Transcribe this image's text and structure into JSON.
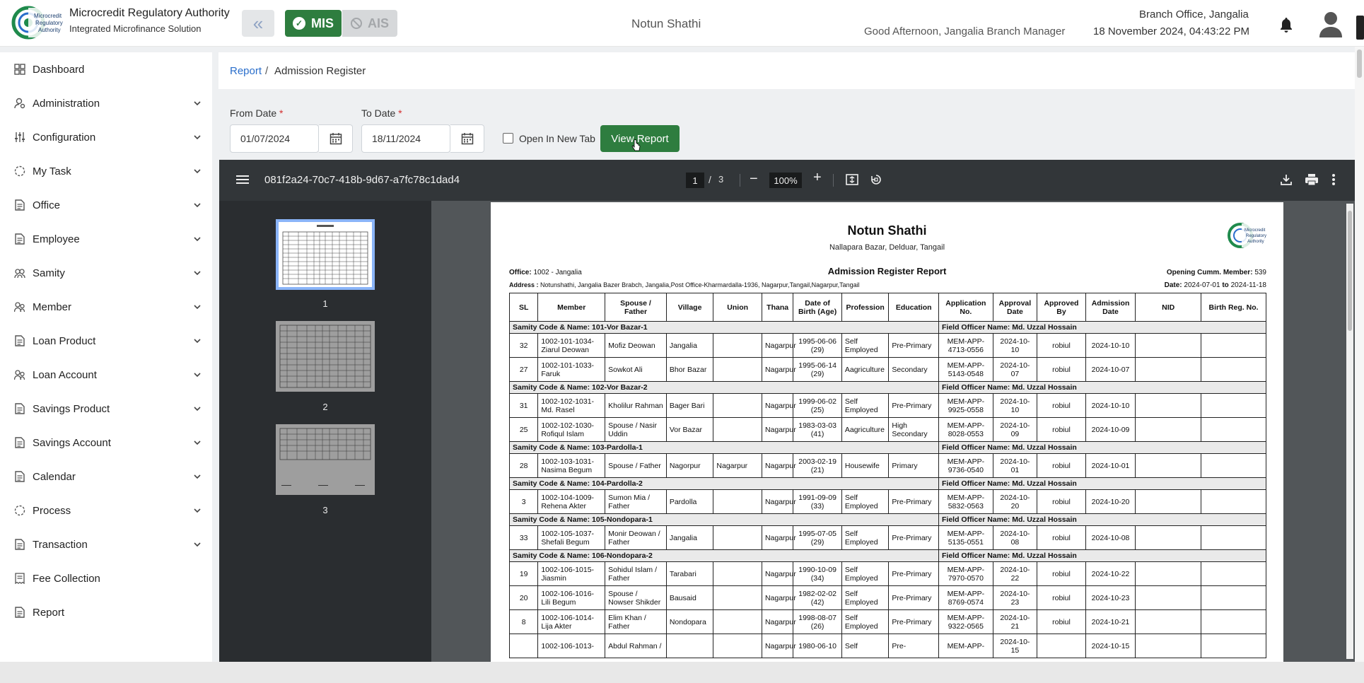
{
  "header": {
    "org_name": "Microcredit Regulatory Authority",
    "org_sub": "Integrated Microfinance Solution",
    "mis_label": "MIS",
    "ais_label": "AIS",
    "center_title": "Notun Shathi",
    "greeting": "Good Afternoon, Jangalia Branch Manager",
    "branch": "Branch Office, Jangalia",
    "datetime": "18 November 2024, 04:43:22 PM"
  },
  "sidebar": {
    "items": [
      {
        "label": "Dashboard",
        "icon": "grid-icon",
        "expandable": false
      },
      {
        "label": "Administration",
        "icon": "user-gear-icon",
        "expandable": true
      },
      {
        "label": "Configuration",
        "icon": "sliders-icon",
        "expandable": true
      },
      {
        "label": "My Task",
        "icon": "circle-dashed-icon",
        "expandable": true
      },
      {
        "label": "Office",
        "icon": "document-icon",
        "expandable": true
      },
      {
        "label": "Employee",
        "icon": "document-icon",
        "expandable": true
      },
      {
        "label": "Samity",
        "icon": "group-icon",
        "expandable": true
      },
      {
        "label": "Member",
        "icon": "members-icon",
        "expandable": true
      },
      {
        "label": "Loan Product",
        "icon": "document-icon",
        "expandable": true
      },
      {
        "label": "Loan Account",
        "icon": "members-icon",
        "expandable": true
      },
      {
        "label": "Savings Product",
        "icon": "document-icon",
        "expandable": true
      },
      {
        "label": "Savings Account",
        "icon": "document-icon",
        "expandable": true
      },
      {
        "label": "Calendar",
        "icon": "document-icon",
        "expandable": true
      },
      {
        "label": "Process",
        "icon": "circle-dashed-icon",
        "expandable": true
      },
      {
        "label": "Transaction",
        "icon": "document-icon",
        "expandable": true
      },
      {
        "label": "Fee Collection",
        "icon": "receipt-icon",
        "expandable": false
      },
      {
        "label": "Report",
        "icon": "document-icon",
        "expandable": false
      }
    ]
  },
  "breadcrumb": {
    "link": "Report",
    "separator": "/",
    "current": "Admission Register"
  },
  "filters": {
    "from_label": "From Date",
    "from_value": "01/07/2024",
    "to_label": "To Date",
    "to_value": "18/11/2024",
    "required_mark": "*",
    "open_new_tab_label": "Open In New Tab",
    "view_report_label": "View Report"
  },
  "pdf_viewer": {
    "file_name": "081f2a24-70c7-418b-9d67-a7fc78c1dad4",
    "current_page": "1",
    "page_separator": "/",
    "total_pages": "3",
    "zoom": "100%",
    "minus": "−",
    "plus": "+",
    "thumbnails": [
      "1",
      "2",
      "3"
    ]
  },
  "report": {
    "title": "Notun Shathi",
    "subtitle": "Nallapara Bazar, Delduar, Tangail",
    "report_name": "Admission Register Report",
    "office_label": "Office:",
    "office_value": "1002 - Jangalia",
    "address_label": "Address :",
    "address_value": "Notunshathi, Jangalia Bazer Brabch, Jangalia,Post Office-Kharmardalla-1936, Nagarpur,Tangail,Nagarpur,Tangail",
    "opening_label": "Opening Cumm. Member:",
    "opening_value": "539",
    "date_label": "Date:",
    "date_from": "2024-07-01",
    "date_to_word": "to",
    "date_to": "2024-11-18",
    "columns": [
      "SL",
      "Member",
      "Spouse / Father",
      "Village",
      "Union",
      "Thana",
      "Date of Birth (Age)",
      "Profession",
      "Education",
      "Application No.",
      "Approval Date",
      "Approved By",
      "Admission Date",
      "NID",
      "Birth Reg. No."
    ],
    "groups": [
      {
        "samity": "Samity Code & Name: 101-Vor Bazar-1",
        "officer": "Field Officer Name: Md. Uzzal Hossain",
        "rows": [
          [
            "32",
            "1002-101-1034-Ziarul Deowan",
            "Mofiz Deowan",
            "Jangalia",
            "",
            "Nagarpur",
            "1995-06-06 (29)",
            "Self Employed",
            "Pre-Primary",
            "MEM-APP-4713-0556",
            "2024-10-10",
            "robiul",
            "2024-10-10",
            "",
            ""
          ],
          [
            "27",
            "1002-101-1033-Faruk",
            "Sowkot Ali",
            "Bhor Bazar",
            "",
            "Nagarpur",
            "1995-06-14 (29)",
            "Aagriculture",
            "Secondary",
            "MEM-APP-5143-0548",
            "2024-10-07",
            "robiul",
            "2024-10-07",
            "",
            ""
          ]
        ]
      },
      {
        "samity": "Samity Code & Name: 102-Vor Bazar-2",
        "officer": "Field Officer Name: Md. Uzzal Hossain",
        "rows": [
          [
            "31",
            "1002-102-1031-Md. Rasel",
            "Kholilur Rahman",
            "Bager Bari",
            "",
            "Nagarpur",
            "1999-06-02 (25)",
            "Self Employed",
            "Pre-Primary",
            "MEM-APP-9925-0558",
            "2024-10-10",
            "robiul",
            "2024-10-10",
            "",
            ""
          ],
          [
            "25",
            "1002-102-1030-Rofiqul Islam",
            "Spouse / Nasir Uddin",
            "Vor Bazar",
            "",
            "Nagarpur",
            "1983-03-03 (41)",
            "Aagriculture",
            "High Secondary",
            "MEM-APP-8028-0553",
            "2024-10-09",
            "robiul",
            "2024-10-09",
            "",
            ""
          ]
        ]
      },
      {
        "samity": "Samity Code & Name: 103-Pardolla-1",
        "officer": "Field Officer Name: Md. Uzzal Hossain",
        "rows": [
          [
            "28",
            "1002-103-1031-Nasima Begum",
            "Spouse / Father",
            "Nagorpur",
            "Nagarpur",
            "Nagarpur",
            "2003-02-19 (21)",
            "Housewife",
            "Primary",
            "MEM-APP-9736-0540",
            "2024-10-01",
            "robiul",
            "2024-10-01",
            "",
            ""
          ]
        ]
      },
      {
        "samity": "Samity Code & Name: 104-Pardolla-2",
        "officer": "Field Officer Name: Md. Uzzal Hossain",
        "rows": [
          [
            "3",
            "1002-104-1009-Rehena Akter",
            "Sumon Mia / Father",
            "Pardolla",
            "",
            "Nagarpur",
            "1991-09-09 (33)",
            "Self Employed",
            "Pre-Primary",
            "MEM-APP-5832-0563",
            "2024-10-20",
            "robiul",
            "2024-10-20",
            "",
            ""
          ]
        ]
      },
      {
        "samity": "Samity Code & Name: 105-Nondopara-1",
        "officer": "Field Officer Name: Md. Uzzal Hossain",
        "rows": [
          [
            "33",
            "1002-105-1037-Shefali Begum",
            "Monir Deowan / Father",
            "Jangalia",
            "",
            "Nagarpur",
            "1995-07-05 (29)",
            "Self Employed",
            "Pre-Primary",
            "MEM-APP-5135-0551",
            "2024-10-08",
            "robiul",
            "2024-10-08",
            "",
            ""
          ]
        ]
      },
      {
        "samity": "Samity Code & Name: 106-Nondopara-2",
        "officer": "Field Officer Name: Md. Uzzal Hossain",
        "rows": [
          [
            "19",
            "1002-106-1015-Jiasmin",
            "Sohidul Islam / Father",
            "Tarabari",
            "",
            "Nagarpur",
            "1990-10-09 (34)",
            "Self Employed",
            "Pre-Primary",
            "MEM-APP-7970-0570",
            "2024-10-22",
            "robiul",
            "2024-10-22",
            "",
            ""
          ],
          [
            "20",
            "1002-106-1016-Lili Begum",
            "Spouse / Nowser Shikder",
            "Bausaid",
            "",
            "Nagarpur",
            "1982-02-02 (42)",
            "Self Employed",
            "Pre-Primary",
            "MEM-APP-8769-0574",
            "2024-10-23",
            "robiul",
            "2024-10-23",
            "",
            ""
          ],
          [
            "8",
            "1002-106-1014-Lija Akter",
            "Elim Khan / Father",
            "Nondopara",
            "",
            "Nagarpur",
            "1998-08-07 (26)",
            "Self Employed",
            "Pre-Primary",
            "MEM-APP-9322-0565",
            "2024-10-21",
            "robiul",
            "2024-10-21",
            "",
            ""
          ],
          [
            "",
            "1002-106-1013-",
            "Abdul Rahman /",
            "",
            "",
            "Nagarpur",
            "1980-06-10",
            "Self",
            "Pre-",
            "MEM-APP-",
            "2024-10-15",
            "",
            "2024-10-15",
            "",
            ""
          ]
        ]
      }
    ]
  },
  "colors": {
    "brand_green": "#2e7d3f",
    "link_blue": "#2a6ecb",
    "viewer_bg": "#525659",
    "toolbar_bg": "#323639"
  }
}
